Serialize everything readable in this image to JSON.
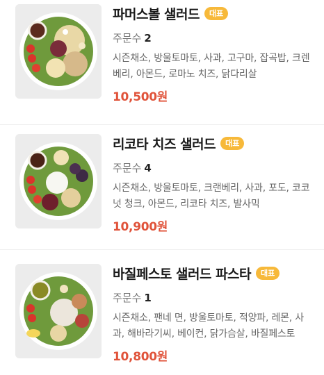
{
  "menu_items": [
    {
      "name": "파머스볼 샐러드",
      "badge": "대표",
      "orders_label": "주문수",
      "orders_count": "2",
      "description": "시즌채소, 방울토마토, 사과, 고구마, 잡곡밥, 크렌베리, 아몬드, 로마노 치즈, 닭다리살",
      "price": "10,500원"
    },
    {
      "name": "리코타 치즈 샐러드",
      "badge": "대표",
      "orders_label": "주문수",
      "orders_count": "4",
      "description": "시즌채소, 방울토마토, 크랜베리, 사과, 포도, 코코넛 청크, 아몬드, 리코타 치즈, 발사믹",
      "price": "10,900원"
    },
    {
      "name": "바질페스토 샐러드 파스타",
      "badge": "대표",
      "orders_label": "주문수",
      "orders_count": "1",
      "description": "시즌채소, 팬네 면, 방울토마토, 적양파, 레몬, 사과, 해바라기씨, 베이컨, 닭가슴살, 바질페스토",
      "price": "10,800원"
    }
  ],
  "colors": {
    "badge": "#f7b93a",
    "price": "#e0533a"
  }
}
